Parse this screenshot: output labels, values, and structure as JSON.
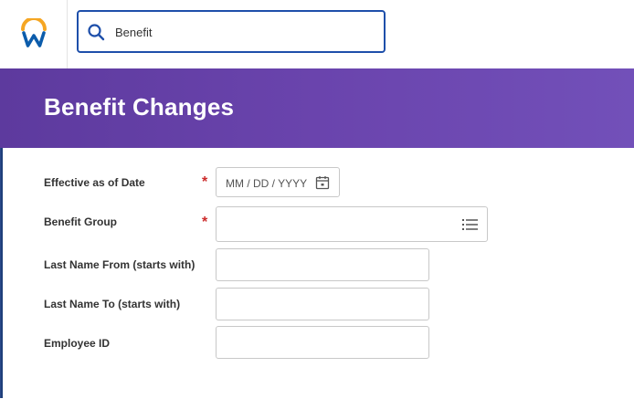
{
  "search": {
    "value": "Benefit"
  },
  "page": {
    "title": "Benefit Changes"
  },
  "form": {
    "effective_date": {
      "label": "Effective as of Date",
      "required_mark": "*",
      "placeholder": "MM / DD / YYYY"
    },
    "benefit_group": {
      "label": "Benefit Group",
      "required_mark": "*",
      "value": ""
    },
    "last_name_from": {
      "label": "Last Name From (starts with)",
      "value": ""
    },
    "last_name_to": {
      "label": "Last Name To (starts with)",
      "value": ""
    },
    "employee_id": {
      "label": "Employee ID",
      "value": ""
    }
  },
  "colors": {
    "brand_orange": "#f5a623",
    "brand_blue": "#0b5cab",
    "banner_purple": "#6a44ad",
    "required_red": "#cc2b2b",
    "search_border": "#1e4faa"
  },
  "icons": [
    "workday-logo-icon",
    "search-icon",
    "calendar-icon",
    "list-icon"
  ]
}
